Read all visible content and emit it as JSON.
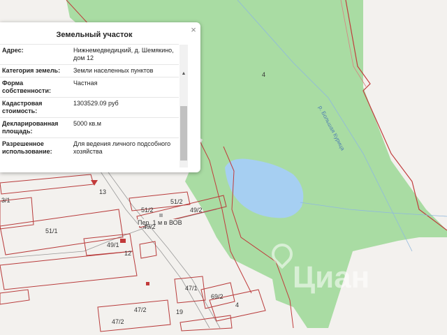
{
  "popup": {
    "title": "Земельный участок",
    "rows": [
      {
        "key": "Адрес:",
        "value": "Нижнемедведицкий, д. Шемякино, дом 12"
      },
      {
        "key": "Категория земель:",
        "value": "Земли населенных пунктов"
      },
      {
        "key": "Форма собственности:",
        "value": "Частная"
      },
      {
        "key": "Кадастровая стоимость:",
        "value": "1303529.09 руб"
      },
      {
        "key": "Декларированная площадь:",
        "value": "5000 кв.м"
      },
      {
        "key": "Разрешенное использование:",
        "value": "Для ведения личного подсобного хозяйства"
      }
    ]
  },
  "map": {
    "labels": {
      "forest_number": "4",
      "river": "р. Большая Курица",
      "street": "Пер. 1 м в ВОВ",
      "p13": "13",
      "p12": "12",
      "p19": "19",
      "p51_2a": "51/2",
      "p51_2b": "51/2",
      "p49_2a": "49/2",
      "p49_2b": "49/2",
      "p51_1": "51/1",
      "p49_1": "49/1",
      "p47_1": "47/1",
      "p47_2a": "47/2",
      "p47_2b": "47/2",
      "p69_2": "69/2",
      "p4b": "4",
      "p3_1": "3/1"
    },
    "watermark": "Циан",
    "colors": {
      "forest": "#a9dca3",
      "water": "#a6cff2",
      "parcel": "#b83a3a"
    }
  }
}
